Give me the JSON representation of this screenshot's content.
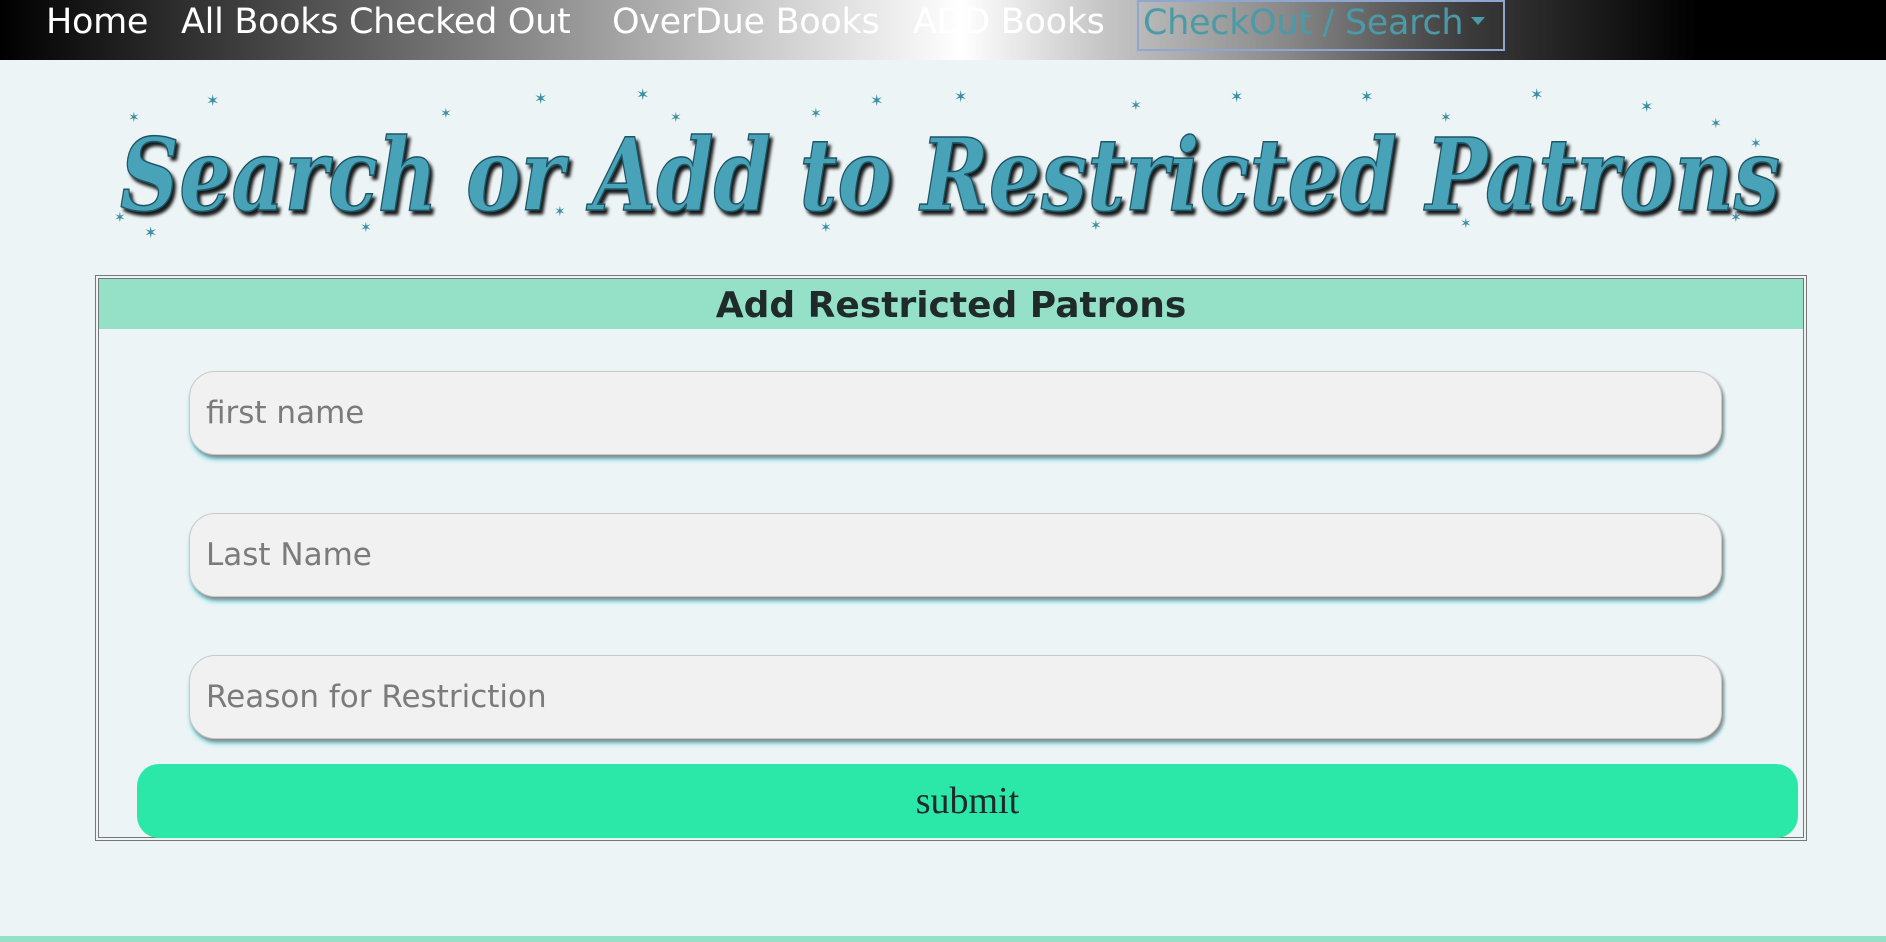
{
  "nav": {
    "home": "Home",
    "all_checked_out": "All Books Checked Out",
    "overdue": "OverDue Books",
    "add_books": "ADD Books",
    "checkout_search": "CheckOut / Search"
  },
  "page": {
    "title": "Search or Add to Restricted Patrons"
  },
  "form": {
    "header": "Add Restricted Patrons",
    "first_name_placeholder": "first name",
    "last_name_placeholder": "Last Name",
    "reason_placeholder": "Reason for Restriction",
    "submit_label": "submit"
  },
  "colors": {
    "background": "#edf4f6",
    "title": "#4aa3b8",
    "header_band": "#95e1c7",
    "submit": "#2ce8a8",
    "dropdown_text": "#4a9aa8"
  }
}
